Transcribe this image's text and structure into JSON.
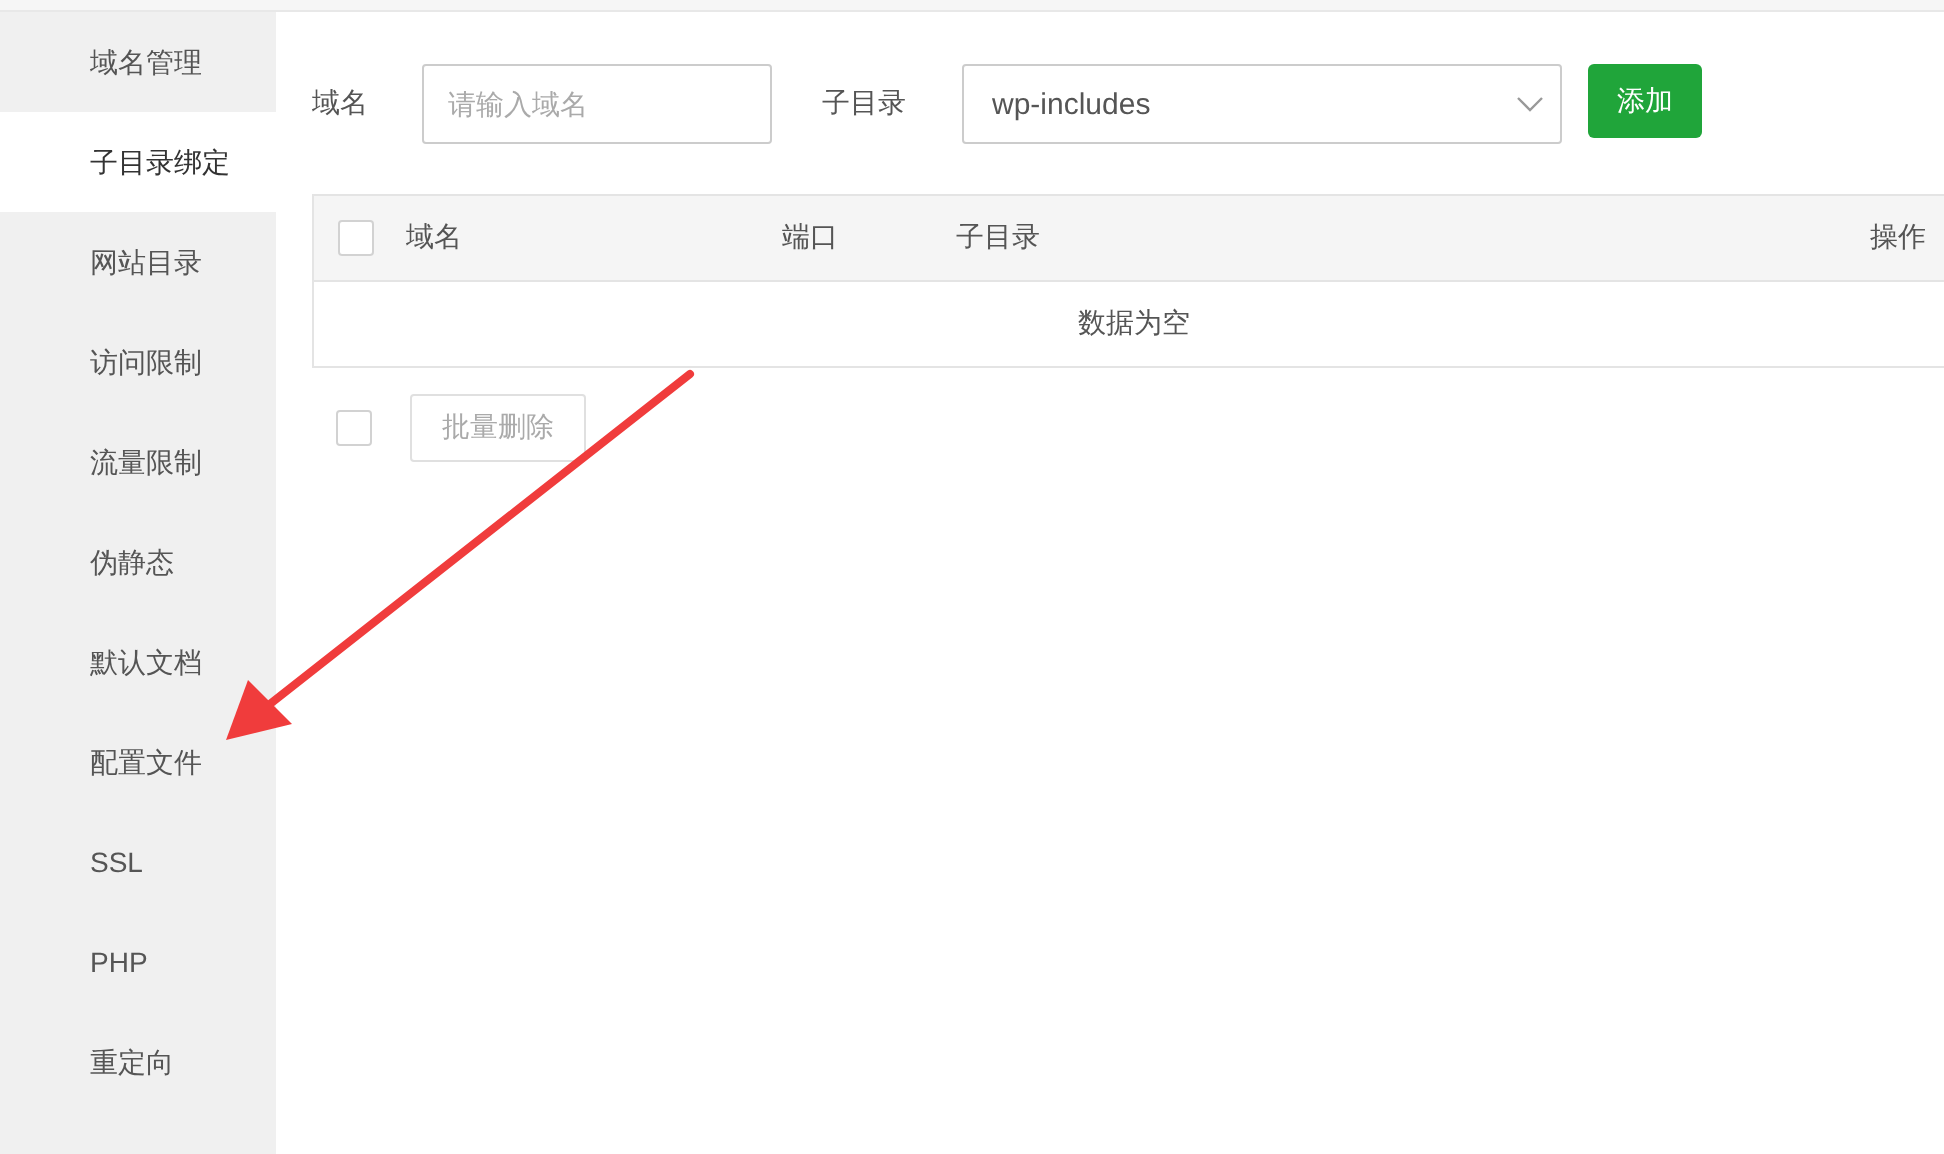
{
  "sidebar": {
    "items": [
      {
        "label": "域名管理",
        "selected": false
      },
      {
        "label": "子目录绑定",
        "selected": true
      },
      {
        "label": "网站目录",
        "selected": false
      },
      {
        "label": "访问限制",
        "selected": false
      },
      {
        "label": "流量限制",
        "selected": false
      },
      {
        "label": "伪静态",
        "selected": false
      },
      {
        "label": "默认文档",
        "selected": false
      },
      {
        "label": "配置文件",
        "selected": false
      },
      {
        "label": "SSL",
        "selected": false
      },
      {
        "label": "PHP",
        "selected": false
      },
      {
        "label": "重定向",
        "selected": false
      }
    ]
  },
  "form": {
    "domain_label": "域名",
    "domain_field": {
      "placeholder": "请输入域名"
    },
    "subdir_label": "子目录",
    "subdir_select": {
      "value": "wp-includes"
    },
    "add_button": "添加"
  },
  "table": {
    "select_all": {
      "checked": false
    },
    "columns": [
      "域名",
      "端口",
      "子目录",
      "操作"
    ],
    "empty_text": "数据为空"
  },
  "footer": {
    "select_all": {
      "checked": false
    },
    "batch_delete_button": {
      "label": "批量删除",
      "disabled": true
    }
  }
}
